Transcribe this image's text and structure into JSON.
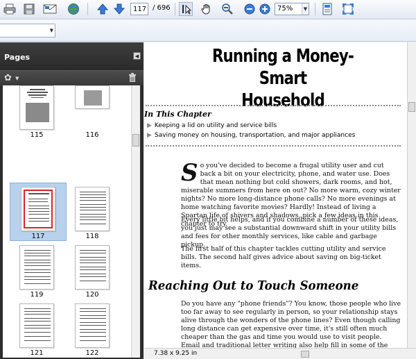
{
  "toolbar": {
    "page_current": "117",
    "page_total": "/ 696",
    "zoom": "75%"
  },
  "sidebar": {
    "title": "Pages",
    "thumbnails": [
      {
        "label": "115"
      },
      {
        "label": "116"
      },
      {
        "label": "117",
        "selected": true
      },
      {
        "label": "118"
      },
      {
        "label": "119"
      },
      {
        "label": "120"
      },
      {
        "label": "121"
      },
      {
        "label": "122"
      }
    ]
  },
  "document": {
    "title_line1": "Running a Money-Smart",
    "title_line2": "Household",
    "in_this_chapter": "In This Chapter",
    "bullets": [
      "Keeping a lid on utility and service bills",
      "Saving money on housing, transportation, and major appliances"
    ],
    "dropcap": "S",
    "para1": "o you've decided to become a frugal utility user and cut back a bit on your electricity, phone, and water use. Does that mean nothing but cold showers, dark rooms, and hot, miserable summers from here on out? No more warm, cozy winter nights? No more long-distance phone calls? No more evenings at home watching favorite movies? Hardly! Instead of living a Spartan life of shivers and shadows, pick a few ideas in this chapter to try.",
    "para2": "Every little bit helps, and if you combine a number of these ideas, you just may see a substantial downward shift in your utility bills and fees for other monthly services, like cable and garbage pickup.",
    "para3": "The first half of this chapter tackles cutting utility and service bills. The second half gives advice about saving on big-ticket items.",
    "section_heading": "Reaching Out to Touch Someone",
    "para4": "Do you have any \"phone friends\"? You know, those people who live too far away to see regularly in person, so your relationship stays alive through the wonders of the phone lines? Even though calling long distance can get expensive over time, it's still often much cheaper than the gas and time you would use to visit people. Email and traditional letter writing also help fill in some of the gaps created by long-distance relationships.",
    "page_size": "7.38 x 9.25 in"
  },
  "icons": {
    "print": "printer-icon",
    "save": "floppy-disk-icon",
    "email": "envelope-icon",
    "web": "globe-icon",
    "prev": "arrow-up-icon",
    "next": "arrow-down-icon",
    "select": "text-select-icon",
    "hand": "hand-icon",
    "marquee": "marquee-zoom-icon",
    "zoom_out": "zoom-out-icon",
    "zoom_in": "zoom-in-icon",
    "fit": "fit-page-icon",
    "fullscreen": "fullscreen-icon"
  },
  "colors": {
    "accent": "#3a7bd5",
    "selection": "#b8d2ee",
    "panel_dark": "#2d2d2d"
  }
}
